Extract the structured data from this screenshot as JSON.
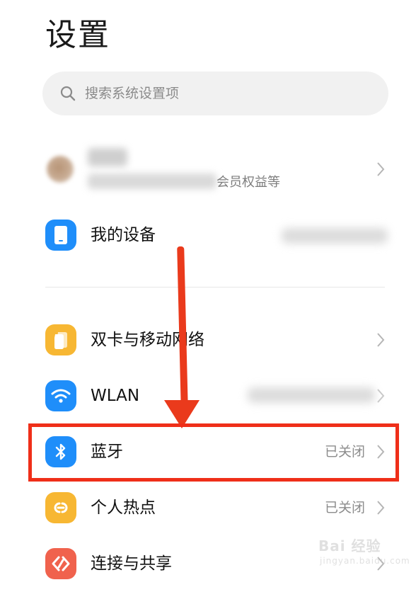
{
  "page": {
    "title": "设置"
  },
  "search": {
    "placeholder": "搜索系统设置项"
  },
  "account": {
    "subtitle_visible": "会员权益等"
  },
  "rows": [
    {
      "label": "我的设备",
      "icon": "phone-icon",
      "color": "#1f8efa"
    },
    {
      "label": "双卡与移动网络",
      "icon": "sim-card-icon",
      "color": "#f7b733"
    },
    {
      "label": "WLAN",
      "icon": "wifi-icon",
      "color": "#1f8efa"
    },
    {
      "label": "蓝牙",
      "icon": "bluetooth-icon",
      "color": "#1f8efa",
      "value": "已关闭"
    },
    {
      "label": "个人热点",
      "icon": "hotspot-icon",
      "color": "#f7b733",
      "value": "已关闭"
    },
    {
      "label": "连接与共享",
      "icon": "share-icon",
      "color": "#f0624d"
    }
  ],
  "annotation": {
    "highlight_color": "#ef2f19"
  },
  "watermark": {
    "text": "Bai 经验",
    "sub": "jingyan.baidu.com"
  }
}
